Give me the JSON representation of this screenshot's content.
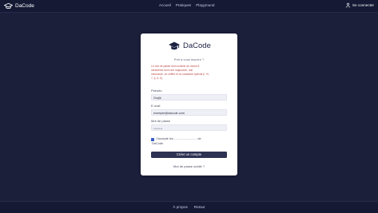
{
  "header": {
    "brand": "DaCode",
    "nav": [
      "Accueil",
      "Pratiques",
      "Playground"
    ],
    "login": "Se connecter"
  },
  "card": {
    "title": "DaCode",
    "subtitle": "Prét à vous inscrire ?",
    "notice_lines": [
      "Le mot de passe doit contenir au moins 8",
      "caractères dont une majuscule, une",
      "minuscule, un chiffre et un caractère spécial (!, %,",
      "?, §, #, £)."
    ],
    "fields": {
      "pseudo_label": "Pseudo",
      "pseudo_value": "Gorjik",
      "email_label": "E-mail",
      "email_value": "exemple@dacode.com",
      "password_label": "Mot de passe",
      "password_value": "••••••••"
    },
    "terms_line1": "J'accepte les ........................... de",
    "terms_line2": "DaCode",
    "submit": "Créer un compte",
    "forgot": "Mot de passe oublié ?"
  },
  "footer": {
    "links": [
      "À propos",
      "Retour"
    ]
  },
  "colors": {
    "background": "#1b1f3a",
    "bar": "#151934",
    "primary_button": "#2d3152",
    "checkbox": "#3a5cc8",
    "notice_text": "#c04848"
  },
  "icons": [
    "graduation-cap-icon",
    "user-icon"
  ]
}
